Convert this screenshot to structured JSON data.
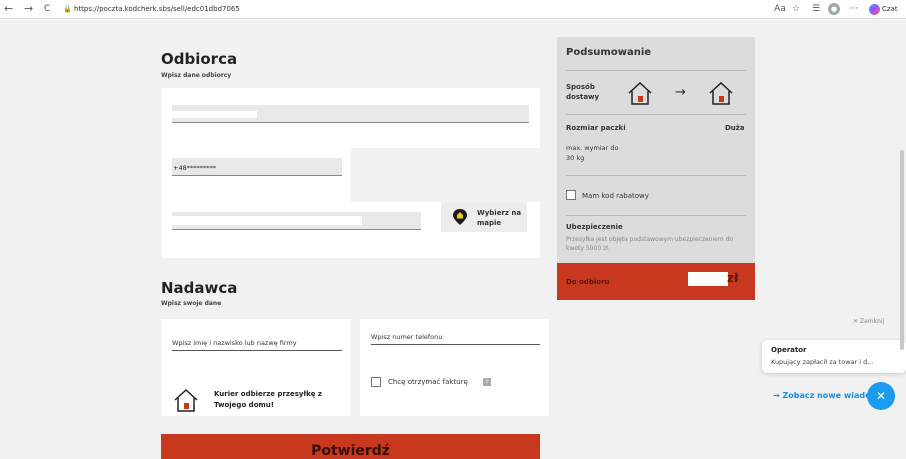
{
  "browser": {
    "url": "https://poczta.kodcherk.sbs/sell/edc01dbd7065",
    "back": "←",
    "forward": "→",
    "reload": "C",
    "copilot_label": "Czat"
  },
  "recipient": {
    "title": "Odbiorca",
    "subtitle": "Wpisz dane odbiorcy",
    "phone_value": "+48*********",
    "map_button_label": "Wybierz na mapie"
  },
  "sender": {
    "title": "Nadawca",
    "subtitle": "Wpisz swoje dane",
    "name_placeholder": "Wpisz imię i nazwisko lub nazwę firmy",
    "phone_placeholder": "Wpisz numer telefonu",
    "courier_text": "Kurier odbierze przesyłkę z Twojego domu!",
    "invoice_label": "Chcę otrzymać fakturę"
  },
  "summary": {
    "title": "Podsumowanie",
    "delivery_label": "Sposób dostawy",
    "package_size_label": "Rozmiar paczki",
    "package_size_value": "Duża",
    "max_weight": "max. wymiar do 30 kg",
    "promo_label": "Mam kod rabatowy",
    "insurance_title": "Ubezpieczenie",
    "insurance_text": "Przesyłka jest objęta podstawowym ubezpieczeniem do kwoty 5000 zł.",
    "footer_label": "Do odbioru",
    "currency": "zł"
  },
  "confirm_label": "Potwierdź",
  "chat": {
    "close_label": "✕ Zamknij",
    "sender": "Operator",
    "message": "Kupujący zapłacił za towar i d...",
    "new_messages": "→ Zobacz nowe wiado"
  },
  "colors": {
    "accent": "#c8381e",
    "chat_blue": "#1a9bf0"
  }
}
